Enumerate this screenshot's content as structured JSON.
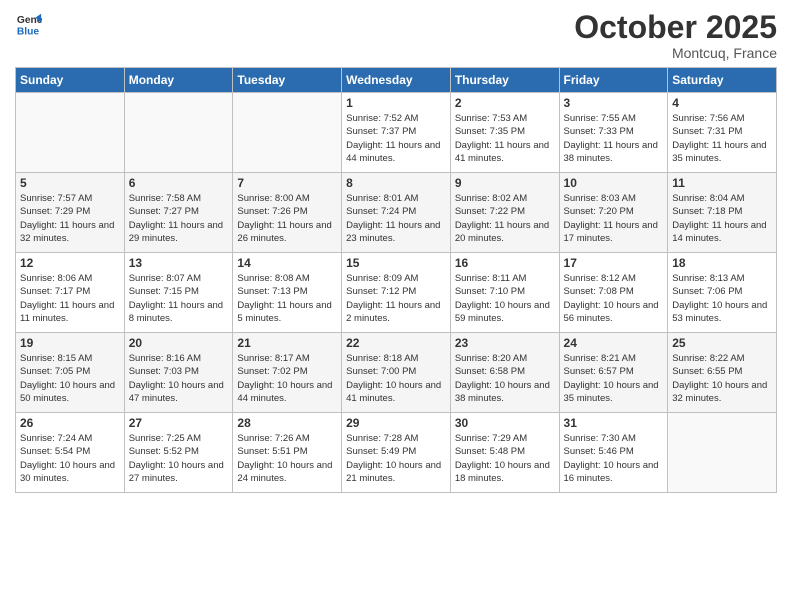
{
  "header": {
    "logo_line1": "General",
    "logo_line2": "Blue",
    "month": "October 2025",
    "location": "Montcuq, France"
  },
  "days_of_week": [
    "Sunday",
    "Monday",
    "Tuesday",
    "Wednesday",
    "Thursday",
    "Friday",
    "Saturday"
  ],
  "weeks": [
    [
      {
        "day": "",
        "sunrise": "",
        "sunset": "",
        "daylight": ""
      },
      {
        "day": "",
        "sunrise": "",
        "sunset": "",
        "daylight": ""
      },
      {
        "day": "",
        "sunrise": "",
        "sunset": "",
        "daylight": ""
      },
      {
        "day": "1",
        "sunrise": "Sunrise: 7:52 AM",
        "sunset": "Sunset: 7:37 PM",
        "daylight": "Daylight: 11 hours and 44 minutes."
      },
      {
        "day": "2",
        "sunrise": "Sunrise: 7:53 AM",
        "sunset": "Sunset: 7:35 PM",
        "daylight": "Daylight: 11 hours and 41 minutes."
      },
      {
        "day": "3",
        "sunrise": "Sunrise: 7:55 AM",
        "sunset": "Sunset: 7:33 PM",
        "daylight": "Daylight: 11 hours and 38 minutes."
      },
      {
        "day": "4",
        "sunrise": "Sunrise: 7:56 AM",
        "sunset": "Sunset: 7:31 PM",
        "daylight": "Daylight: 11 hours and 35 minutes."
      }
    ],
    [
      {
        "day": "5",
        "sunrise": "Sunrise: 7:57 AM",
        "sunset": "Sunset: 7:29 PM",
        "daylight": "Daylight: 11 hours and 32 minutes."
      },
      {
        "day": "6",
        "sunrise": "Sunrise: 7:58 AM",
        "sunset": "Sunset: 7:27 PM",
        "daylight": "Daylight: 11 hours and 29 minutes."
      },
      {
        "day": "7",
        "sunrise": "Sunrise: 8:00 AM",
        "sunset": "Sunset: 7:26 PM",
        "daylight": "Daylight: 11 hours and 26 minutes."
      },
      {
        "day": "8",
        "sunrise": "Sunrise: 8:01 AM",
        "sunset": "Sunset: 7:24 PM",
        "daylight": "Daylight: 11 hours and 23 minutes."
      },
      {
        "day": "9",
        "sunrise": "Sunrise: 8:02 AM",
        "sunset": "Sunset: 7:22 PM",
        "daylight": "Daylight: 11 hours and 20 minutes."
      },
      {
        "day": "10",
        "sunrise": "Sunrise: 8:03 AM",
        "sunset": "Sunset: 7:20 PM",
        "daylight": "Daylight: 11 hours and 17 minutes."
      },
      {
        "day": "11",
        "sunrise": "Sunrise: 8:04 AM",
        "sunset": "Sunset: 7:18 PM",
        "daylight": "Daylight: 11 hours and 14 minutes."
      }
    ],
    [
      {
        "day": "12",
        "sunrise": "Sunrise: 8:06 AM",
        "sunset": "Sunset: 7:17 PM",
        "daylight": "Daylight: 11 hours and 11 minutes."
      },
      {
        "day": "13",
        "sunrise": "Sunrise: 8:07 AM",
        "sunset": "Sunset: 7:15 PM",
        "daylight": "Daylight: 11 hours and 8 minutes."
      },
      {
        "day": "14",
        "sunrise": "Sunrise: 8:08 AM",
        "sunset": "Sunset: 7:13 PM",
        "daylight": "Daylight: 11 hours and 5 minutes."
      },
      {
        "day": "15",
        "sunrise": "Sunrise: 8:09 AM",
        "sunset": "Sunset: 7:12 PM",
        "daylight": "Daylight: 11 hours and 2 minutes."
      },
      {
        "day": "16",
        "sunrise": "Sunrise: 8:11 AM",
        "sunset": "Sunset: 7:10 PM",
        "daylight": "Daylight: 10 hours and 59 minutes."
      },
      {
        "day": "17",
        "sunrise": "Sunrise: 8:12 AM",
        "sunset": "Sunset: 7:08 PM",
        "daylight": "Daylight: 10 hours and 56 minutes."
      },
      {
        "day": "18",
        "sunrise": "Sunrise: 8:13 AM",
        "sunset": "Sunset: 7:06 PM",
        "daylight": "Daylight: 10 hours and 53 minutes."
      }
    ],
    [
      {
        "day": "19",
        "sunrise": "Sunrise: 8:15 AM",
        "sunset": "Sunset: 7:05 PM",
        "daylight": "Daylight: 10 hours and 50 minutes."
      },
      {
        "day": "20",
        "sunrise": "Sunrise: 8:16 AM",
        "sunset": "Sunset: 7:03 PM",
        "daylight": "Daylight: 10 hours and 47 minutes."
      },
      {
        "day": "21",
        "sunrise": "Sunrise: 8:17 AM",
        "sunset": "Sunset: 7:02 PM",
        "daylight": "Daylight: 10 hours and 44 minutes."
      },
      {
        "day": "22",
        "sunrise": "Sunrise: 8:18 AM",
        "sunset": "Sunset: 7:00 PM",
        "daylight": "Daylight: 10 hours and 41 minutes."
      },
      {
        "day": "23",
        "sunrise": "Sunrise: 8:20 AM",
        "sunset": "Sunset: 6:58 PM",
        "daylight": "Daylight: 10 hours and 38 minutes."
      },
      {
        "day": "24",
        "sunrise": "Sunrise: 8:21 AM",
        "sunset": "Sunset: 6:57 PM",
        "daylight": "Daylight: 10 hours and 35 minutes."
      },
      {
        "day": "25",
        "sunrise": "Sunrise: 8:22 AM",
        "sunset": "Sunset: 6:55 PM",
        "daylight": "Daylight: 10 hours and 32 minutes."
      }
    ],
    [
      {
        "day": "26",
        "sunrise": "Sunrise: 7:24 AM",
        "sunset": "Sunset: 5:54 PM",
        "daylight": "Daylight: 10 hours and 30 minutes."
      },
      {
        "day": "27",
        "sunrise": "Sunrise: 7:25 AM",
        "sunset": "Sunset: 5:52 PM",
        "daylight": "Daylight: 10 hours and 27 minutes."
      },
      {
        "day": "28",
        "sunrise": "Sunrise: 7:26 AM",
        "sunset": "Sunset: 5:51 PM",
        "daylight": "Daylight: 10 hours and 24 minutes."
      },
      {
        "day": "29",
        "sunrise": "Sunrise: 7:28 AM",
        "sunset": "Sunset: 5:49 PM",
        "daylight": "Daylight: 10 hours and 21 minutes."
      },
      {
        "day": "30",
        "sunrise": "Sunrise: 7:29 AM",
        "sunset": "Sunset: 5:48 PM",
        "daylight": "Daylight: 10 hours and 18 minutes."
      },
      {
        "day": "31",
        "sunrise": "Sunrise: 7:30 AM",
        "sunset": "Sunset: 5:46 PM",
        "daylight": "Daylight: 10 hours and 16 minutes."
      },
      {
        "day": "",
        "sunrise": "",
        "sunset": "",
        "daylight": ""
      }
    ]
  ]
}
